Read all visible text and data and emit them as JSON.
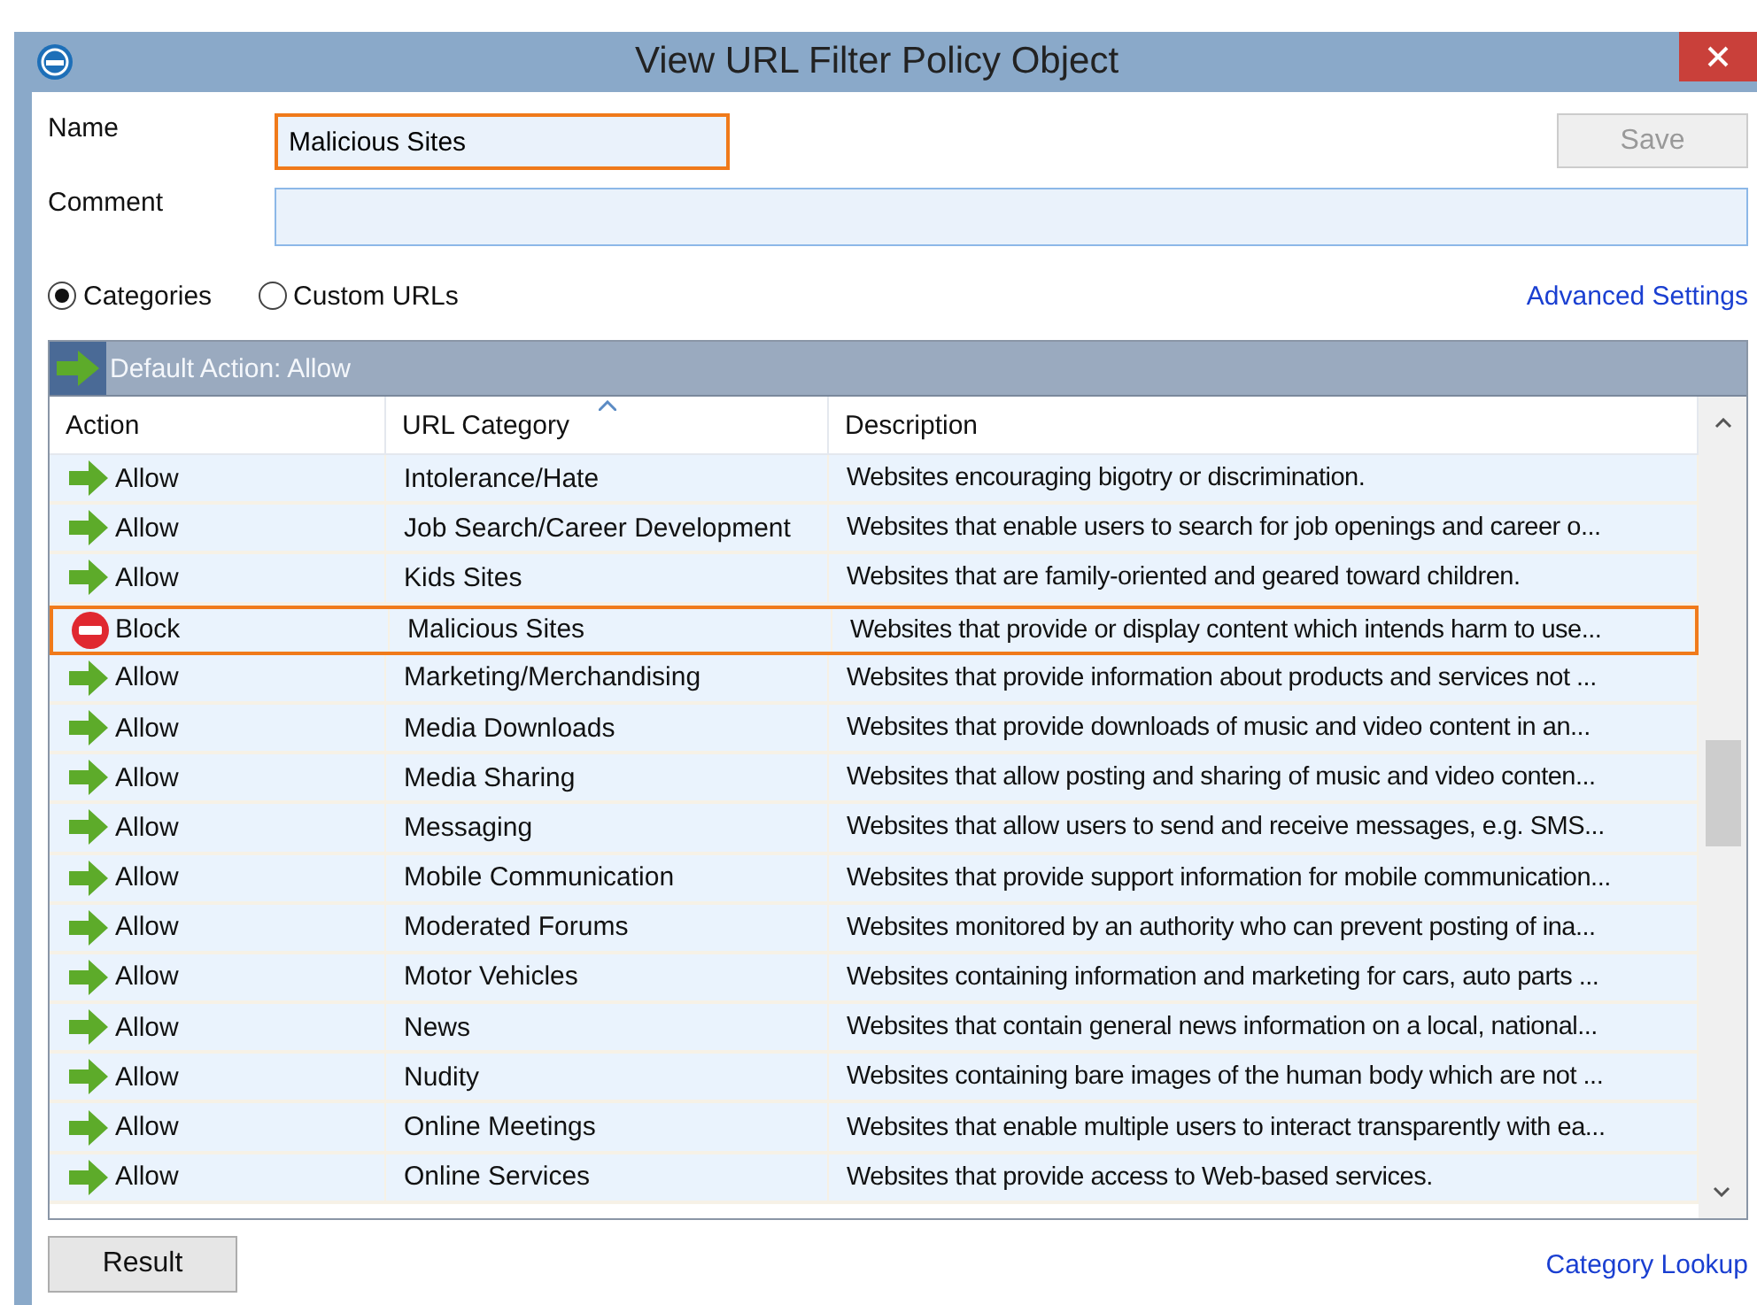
{
  "window": {
    "title": "View URL Filter Policy Object"
  },
  "name_field": {
    "label": "Name",
    "value": "Malicious Sites"
  },
  "save_button": {
    "label": "Save",
    "disabled": true
  },
  "comment_field": {
    "label": "Comment"
  },
  "modes": [
    {
      "label": "Categories",
      "selected": true
    },
    {
      "label": "Custom URLs",
      "selected": false
    }
  ],
  "advanced_link": "Advanced Settings",
  "default_action": "Default Action: Allow",
  "columns": [
    {
      "label": "Action",
      "sorted": false
    },
    {
      "label": "URL Category",
      "sorted": true
    },
    {
      "label": "Description",
      "sorted": false
    }
  ],
  "rows": [
    {
      "kind": "allow",
      "action": "Allow",
      "category": "Intolerance/Hate",
      "description": "Websites encouraging bigotry or discrimination.",
      "selected": false
    },
    {
      "kind": "allow",
      "action": "Allow",
      "category": "Job Search/Career Development",
      "description": "Websites that enable users to search for job openings and career o...",
      "selected": false
    },
    {
      "kind": "allow",
      "action": "Allow",
      "category": "Kids Sites",
      "description": "Websites that are family-oriented and geared toward children.",
      "selected": false
    },
    {
      "kind": "block",
      "action": "Block",
      "category": "Malicious Sites",
      "description": "Websites that provide or display content which intends harm to use...",
      "selected": true
    },
    {
      "kind": "allow",
      "action": "Allow",
      "category": "Marketing/Merchandising",
      "description": "Websites that provide information about products and services not ...",
      "selected": false
    },
    {
      "kind": "allow",
      "action": "Allow",
      "category": "Media Downloads",
      "description": "Websites that provide downloads of music and video content in an...",
      "selected": false
    },
    {
      "kind": "allow",
      "action": "Allow",
      "category": "Media Sharing",
      "description": "Websites that allow posting and sharing of music and video conten...",
      "selected": false
    },
    {
      "kind": "allow",
      "action": "Allow",
      "category": "Messaging",
      "description": "Websites that allow users to send and receive messages, e.g. SMS...",
      "selected": false
    },
    {
      "kind": "allow",
      "action": "Allow",
      "category": "Mobile Communication",
      "description": "Websites that provide support information for mobile communication...",
      "selected": false
    },
    {
      "kind": "allow",
      "action": "Allow",
      "category": "Moderated Forums",
      "description": "Websites monitored by an authority who can prevent posting of ina...",
      "selected": false
    },
    {
      "kind": "allow",
      "action": "Allow",
      "category": "Motor Vehicles",
      "description": "Websites containing information and marketing for cars, auto parts ...",
      "selected": false
    },
    {
      "kind": "allow",
      "action": "Allow",
      "category": "News",
      "description": "Websites that contain general news information on a local, national...",
      "selected": false
    },
    {
      "kind": "allow",
      "action": "Allow",
      "category": "Nudity",
      "description": "Websites containing bare images of the human body which are not ...",
      "selected": false
    },
    {
      "kind": "allow",
      "action": "Allow",
      "category": "Online Meetings",
      "description": "Websites that enable multiple users to interact transparently with ea...",
      "selected": false
    },
    {
      "kind": "allow",
      "action": "Allow",
      "category": "Online Services",
      "description": "Websites that provide access to Web-based services.",
      "selected": false
    }
  ],
  "result_button": "Result",
  "lookup_link": "Category Lookup"
}
